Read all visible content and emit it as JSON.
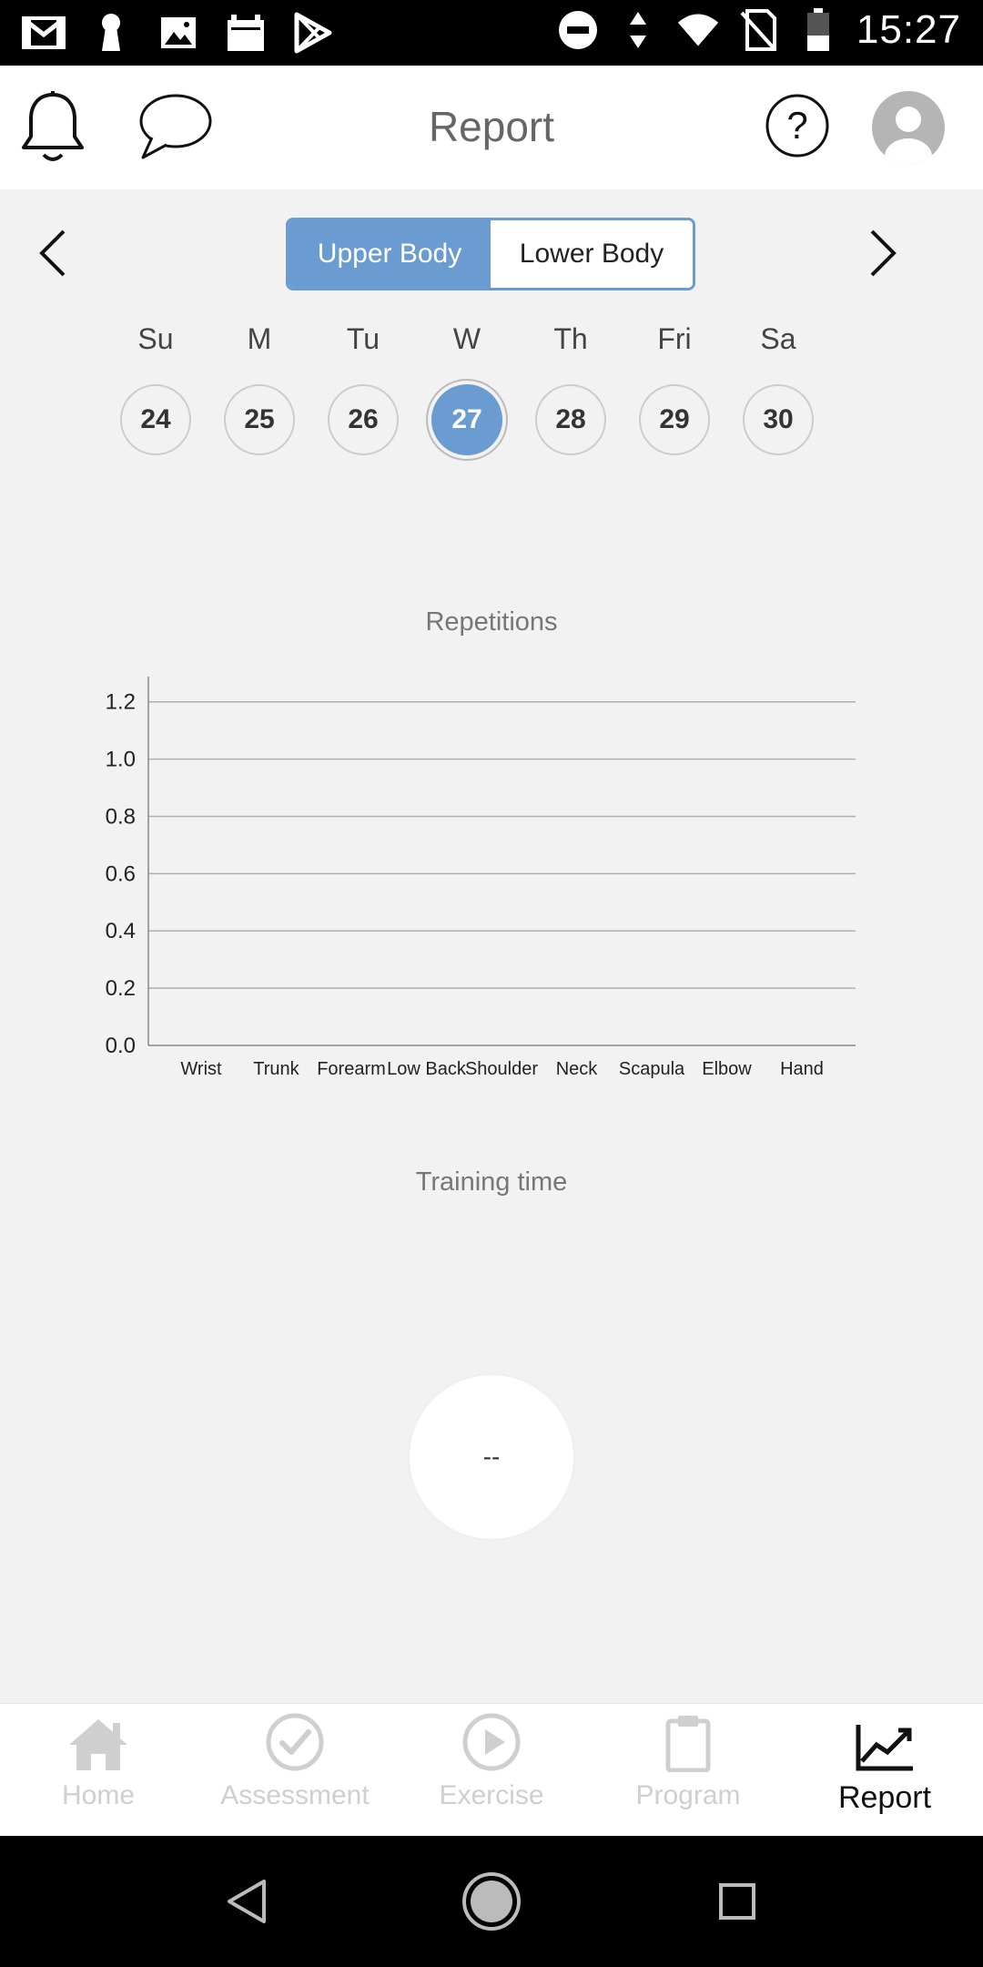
{
  "status_bar": {
    "time": "15:27",
    "left_icons": [
      "gmail-icon",
      "keyhole-icon",
      "image-icon",
      "calendar-icon",
      "play-store-icon"
    ],
    "right_icons": [
      "dnd-icon",
      "data-arrows-icon",
      "wifi-icon",
      "no-sim-icon",
      "battery-icon"
    ]
  },
  "header": {
    "title": "Report",
    "left_buttons": [
      "bell-icon",
      "chat-icon"
    ],
    "right_buttons": [
      "help-icon",
      "profile-icon"
    ]
  },
  "segment": {
    "options": [
      "Upper Body",
      "Lower Body"
    ],
    "selected": "Upper Body",
    "accent_color": "#6a9bd1"
  },
  "week": {
    "days": [
      {
        "label": "Su",
        "num": "24"
      },
      {
        "label": "M",
        "num": "25"
      },
      {
        "label": "Tu",
        "num": "26"
      },
      {
        "label": "W",
        "num": "27"
      },
      {
        "label": "Th",
        "num": "28"
      },
      {
        "label": "Fri",
        "num": "29"
      },
      {
        "label": "Sa",
        "num": "30"
      }
    ],
    "selected_index": 3
  },
  "repetitions": {
    "title": "Repetitions"
  },
  "chart_data": {
    "type": "bar",
    "title": "Repetitions",
    "categories": [
      "Wrist",
      "Trunk",
      "Forearm",
      "Low Back",
      "Shoulder",
      "Neck",
      "Scapula",
      "Elbow",
      "Hand"
    ],
    "values": [
      0,
      0,
      0,
      0,
      0,
      0,
      0,
      0,
      0
    ],
    "y_ticks": [
      "0.0",
      "0.2",
      "0.4",
      "0.6",
      "0.8",
      "1.0",
      "1.2"
    ],
    "ylim": [
      0,
      1.25
    ],
    "grid": true,
    "xlabel": "",
    "ylabel": ""
  },
  "training": {
    "title": "Training time",
    "value": "--"
  },
  "tabs": [
    {
      "label": "Home",
      "icon": "home-icon",
      "active": false
    },
    {
      "label": "Assessment",
      "icon": "check-circle-icon",
      "active": false
    },
    {
      "label": "Exercise",
      "icon": "play-circle-icon",
      "active": false
    },
    {
      "label": "Program",
      "icon": "clipboard-icon",
      "active": false
    },
    {
      "label": "Report",
      "icon": "trend-chart-icon",
      "active": true
    }
  ],
  "nav_bar": [
    "back-icon",
    "home-circle-icon",
    "recents-icon"
  ]
}
